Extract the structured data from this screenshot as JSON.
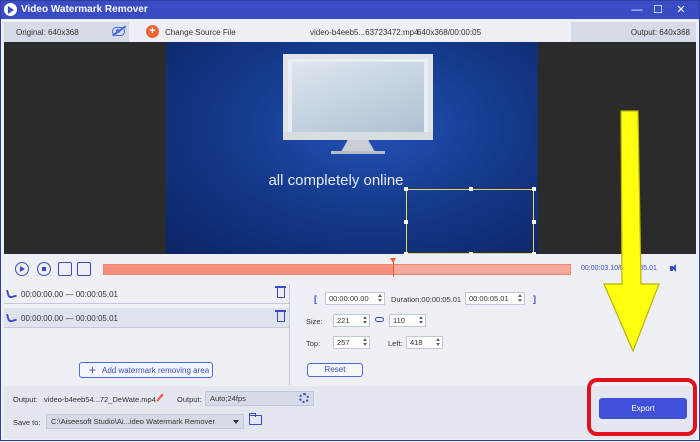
{
  "window": {
    "title": "Video Watermark Remover",
    "controls": {
      "minimize": "—",
      "maximize": "☐",
      "close": "✕"
    }
  },
  "infobar": {
    "original_label": "Original: 640x368",
    "change_source_label": "Change Source File",
    "filename": "video-b4eeb5...63723472.mp4",
    "file_info": "640x368/00:00:05",
    "output_label": "Output: 640x368"
  },
  "preview": {
    "caption": "all completely online"
  },
  "timeline": {
    "time_readout": "00:00:03.10/00:00:05.01",
    "playhead_fraction": 0.62,
    "colors": {
      "accent": "#3a4cc4",
      "track": "#f5a99a",
      "playhead": "#ef5a30"
    }
  },
  "ranges": [
    {
      "text": "00:00:00.00 — 00:00:05.01"
    },
    {
      "text": "00:00:00.00 — 00:00:05.01"
    }
  ],
  "left_panel": {
    "add_area_label": "Add watermark removing area"
  },
  "right_panel": {
    "start_time": "00:00:00.00",
    "duration_label": "Duration:00:00:05.01",
    "end_time": "00:00:05.01",
    "bracket_open": "[",
    "bracket_close": "]",
    "size_label": "Size:",
    "width": "221",
    "height": "110",
    "top_label": "Top:",
    "top_value": "257",
    "left_label": "Left:",
    "left_value": "418",
    "reset_label": "Reset"
  },
  "bottom": {
    "output_label": "Output:",
    "output_file": "video-b4eeb54...72_DeWate.mp4",
    "output_format_label": "Output:",
    "output_format": "Auto;24fps",
    "save_to_label": "Save to:",
    "save_path": "C:\\Aiseesoft Studio\\Ai...ideo Watermark Remover",
    "export_label": "Export"
  }
}
